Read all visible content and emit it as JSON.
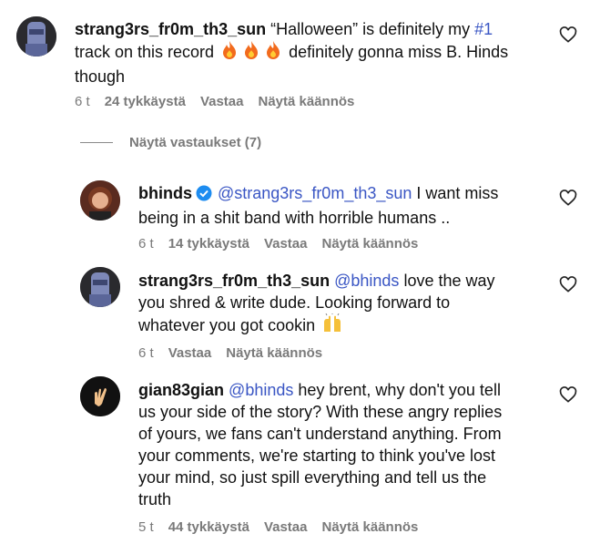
{
  "colors": {
    "mention": "#3a56c4",
    "meta": "#7a7a7a",
    "verified": "#1d8cf0"
  },
  "comments": [
    {
      "username": "strang3rs_fr0m_th3_sun",
      "text_before": " “Halloween” is definitely my ",
      "hashtag": "#1",
      "line2a": "track on this record ",
      "line2b": " definitely gonna miss B. Hinds",
      "line3": "though",
      "emoji_icon": "fire-icon",
      "time": "6 t",
      "likes": "24 tykkäystä",
      "reply": "Vastaa",
      "translate": "Näytä käännös"
    },
    {
      "username": "bhinds",
      "mention": "@strang3rs_fr0m_th3_sun",
      "text1": " I want miss",
      "text2": "being in a shit band with horrible humans ..",
      "time": "6 t",
      "likes": "14 tykkäystä",
      "reply": "Vastaa",
      "translate": "Näytä käännös"
    },
    {
      "username": "strang3rs_fr0m_th3_sun",
      "mention": "@bhinds",
      "text1": " love the way",
      "text2": "you shred & write dude. Looking forward to",
      "text3": "whatever you got cookin ",
      "emoji_icon": "raising-hands-icon",
      "time": "6 t",
      "reply": "Vastaa",
      "translate": "Näytä käännös"
    },
    {
      "username": "gian83gian",
      "mention": "@bhinds",
      "text1": " hey brent, why don't you tell",
      "text2": "us your side of the story? With these angry replies",
      "text3": "of yours, we fans can't understand anything. From",
      "text4": "your comments, we're starting to think you've lost",
      "text5": "your mind, so just spill everything and tell us the",
      "text6": "truth",
      "time": "5 t",
      "likes": "44 tykkäystä",
      "reply": "Vastaa",
      "translate": "Näytä käännös"
    }
  ],
  "view_replies": "Näytä vastaukset (7)"
}
